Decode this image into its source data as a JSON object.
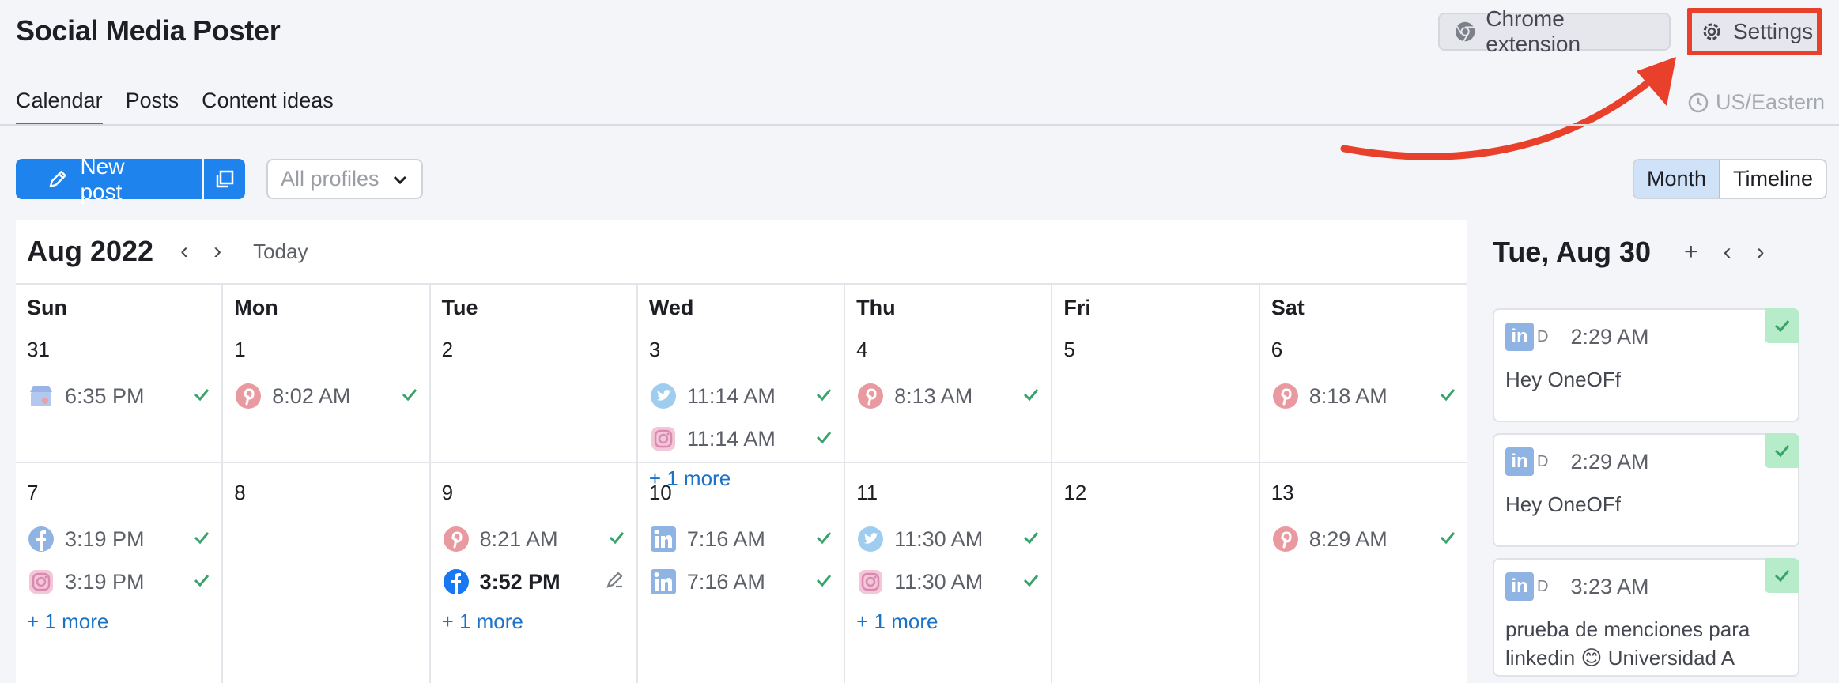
{
  "app": {
    "title": "Social Media Poster"
  },
  "header": {
    "chrome_extension": "Chrome extension",
    "settings": "Settings",
    "timezone": "US/Eastern"
  },
  "tabs": [
    {
      "label": "Calendar"
    },
    {
      "label": "Posts"
    },
    {
      "label": "Content ideas"
    }
  ],
  "toolbar": {
    "new_post": "New post",
    "profiles_placeholder": "All profiles",
    "view_month": "Month",
    "view_timeline": "Timeline"
  },
  "calendar": {
    "month": "Aug 2022",
    "today": "Today",
    "days": [
      "Sun",
      "Mon",
      "Tue",
      "Wed",
      "Thu",
      "Fri",
      "Sat"
    ],
    "weeks": [
      [
        {
          "date": "31",
          "posts": [
            {
              "network": "gmb",
              "time": "6:35 PM"
            }
          ]
        },
        {
          "date": "1",
          "posts": [
            {
              "network": "pinterest",
              "time": "8:02 AM"
            }
          ]
        },
        {
          "date": "2",
          "posts": []
        },
        {
          "date": "3",
          "posts": [
            {
              "network": "twitter",
              "time": "11:14 AM"
            },
            {
              "network": "instagram",
              "time": "11:14 AM"
            }
          ],
          "more": "+ 1 more"
        },
        {
          "date": "4",
          "posts": [
            {
              "network": "pinterest",
              "time": "8:13 AM"
            }
          ]
        },
        {
          "date": "5",
          "posts": []
        },
        {
          "date": "6",
          "posts": [
            {
              "network": "pinterest",
              "time": "8:18 AM"
            }
          ]
        }
      ],
      [
        {
          "date": "7",
          "posts": [
            {
              "network": "facebook",
              "time": "3:19 PM"
            },
            {
              "network": "instagram",
              "time": "3:19 PM"
            }
          ],
          "more": "+ 1 more"
        },
        {
          "date": "8",
          "posts": []
        },
        {
          "date": "9",
          "posts": [
            {
              "network": "pinterest",
              "time": "8:21 AM"
            },
            {
              "network": "facebook-draft",
              "time": "3:52 PM"
            }
          ],
          "more": "+ 1 more"
        },
        {
          "date": "10",
          "posts": [
            {
              "network": "linkedin",
              "time": "7:16 AM"
            },
            {
              "network": "linkedin",
              "time": "7:16 AM"
            }
          ]
        },
        {
          "date": "11",
          "posts": [
            {
              "network": "twitter",
              "time": "11:30 AM"
            },
            {
              "network": "instagram",
              "time": "11:30 AM"
            }
          ],
          "more": "+ 1 more"
        },
        {
          "date": "12",
          "posts": []
        },
        {
          "date": "13",
          "posts": [
            {
              "network": "pinterest",
              "time": "8:29 AM"
            }
          ]
        }
      ]
    ]
  },
  "side": {
    "title": "Tue, Aug 30",
    "cards": [
      {
        "badge": "in",
        "sub": "D",
        "time": "2:29 AM",
        "text": "Hey OneOFf"
      },
      {
        "badge": "in",
        "sub": "D",
        "time": "2:29 AM",
        "text": "Hey OneOFf"
      },
      {
        "badge": "in",
        "sub": "D",
        "time": "3:23 AM",
        "text": "prueba de menciones para linkedin 😊 Universidad A"
      }
    ]
  },
  "colors": {
    "accent": "#1e83ec",
    "highlight": "#e8402a",
    "success": "#3aa36b"
  }
}
